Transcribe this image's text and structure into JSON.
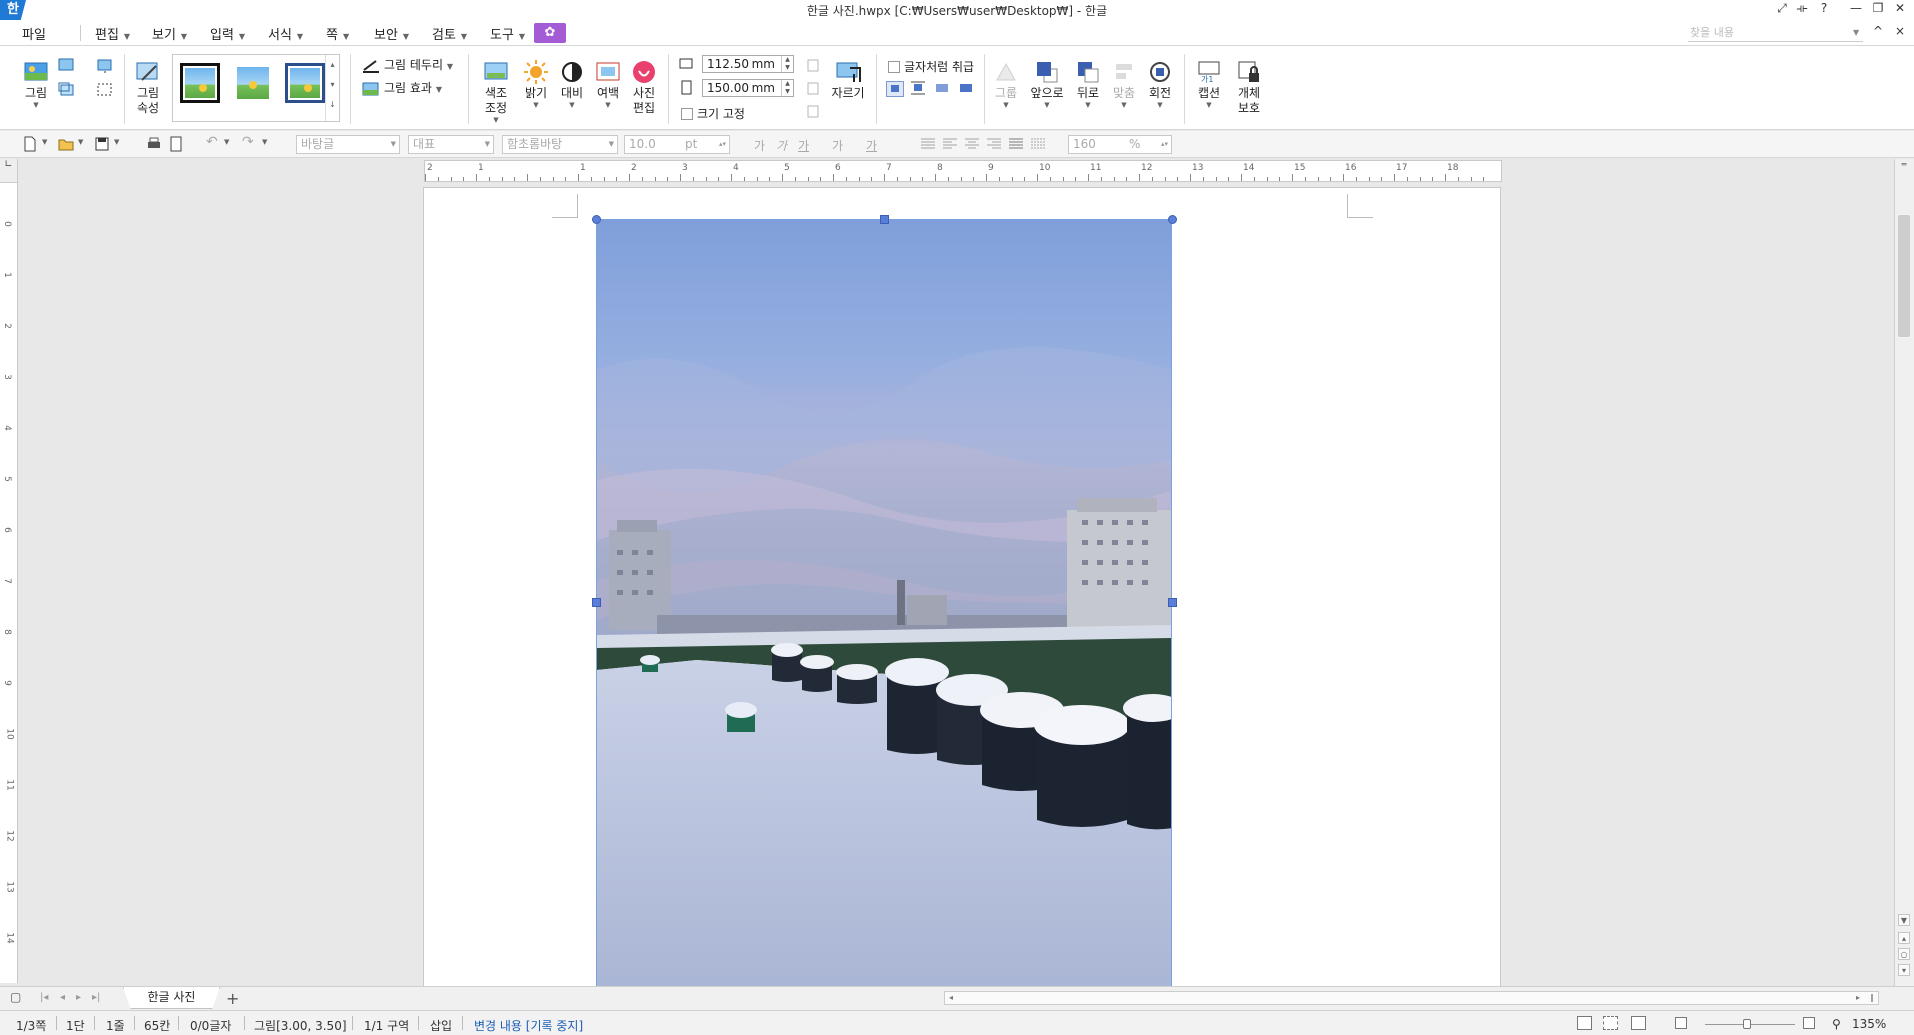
{
  "titlebar": {
    "app_logo": "한",
    "title": "한글 사진.hwpx [C:₩Users₩user₩Desktop₩] - 한글",
    "controls": [
      "⤢",
      "⟛",
      "?",
      "—",
      "❐",
      "✕"
    ]
  },
  "menu": {
    "file": "파일",
    "items": [
      "편집",
      "보기",
      "입력",
      "서식",
      "쪽",
      "보안",
      "검토",
      "도구"
    ],
    "special_icon": "tulip-icon",
    "search_placeholder": "찾을 내용",
    "right_controls": [
      "^",
      "×"
    ]
  },
  "ribbon": {
    "picture": "그림",
    "picture_props": "그림\n속성",
    "border": "그림 테두리",
    "effect": "그림 효과",
    "color_adjust": "색조\n조정",
    "brightness": "밝기",
    "contrast": "대비",
    "margin": "여백",
    "photo_edit": "사진\n편집",
    "width_value": "112.50",
    "height_value": "150.00",
    "unit": "mm",
    "lock_size": "크기 고정",
    "crop": "자르기",
    "treat_as_char": "글자처럼 취급",
    "group": "그룹",
    "bring_front": "앞으로",
    "send_back": "뒤로",
    "align": "맞춤",
    "rotate": "회전",
    "caption": "캡션",
    "protect": "개체\n보호"
  },
  "format": {
    "style": "바탕글",
    "lang": "대표",
    "font": "함초롬바탕",
    "size": "10.0",
    "size_unit": "pt",
    "bold": "가",
    "italic": "가",
    "underline": "가",
    "strike": "가",
    "color": "가",
    "line_spacing": "160",
    "line_unit": "%"
  },
  "ruler": {
    "h": [
      "2",
      "1",
      "",
      "1",
      "2",
      "3",
      "4",
      "5",
      "6",
      "7",
      "8",
      "9",
      "10",
      "11",
      "12",
      "13",
      "14",
      "15",
      "16",
      "17",
      "18"
    ],
    "v": [
      "0",
      "1",
      "2",
      "3",
      "4",
      "5",
      "6",
      "7",
      "8",
      "9",
      "10",
      "11",
      "12",
      "13",
      "14"
    ]
  },
  "tabs": {
    "doc_tab": "한글 사진",
    "add": "+"
  },
  "status": {
    "page": "1/3쪽",
    "column": "1단",
    "line": "1줄",
    "col": "65칸",
    "chars": "0/0글자",
    "object": "그림[3.00, 3.50]",
    "section": "1/1 구역",
    "mode": "삽입",
    "track": "변경 내용 [기록 중지]",
    "zoom": "135%"
  },
  "colors": {
    "accent": "#1f7ad6",
    "special": "#a45bd6",
    "handle": "#5a7fd8",
    "status_link": "#1c5fb6"
  }
}
